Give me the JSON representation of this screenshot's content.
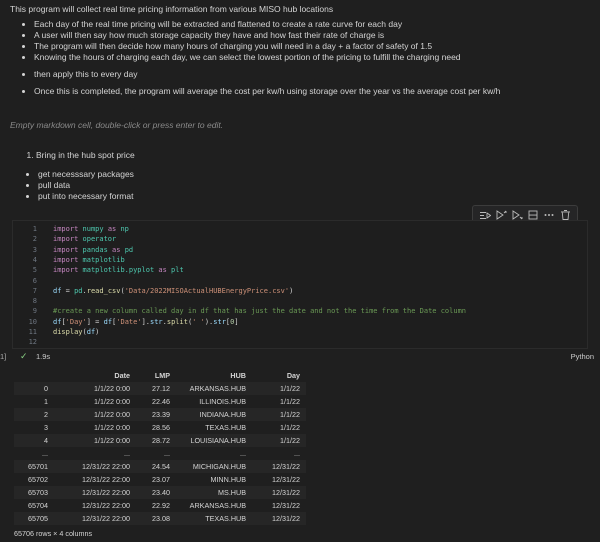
{
  "intro": {
    "text": "This program will collect real time pricing information from various MISO hub locations",
    "bullets": [
      "Each day of the real time pricing will be extracted and flattened to create a rate curve for each day",
      "A user will then say how much storage capacity they have and how fast their rate of charge is",
      "The program will then decide how many hours of charging you will need in a day + a factor of safety of 1.5",
      "Knowing the hours of charging each day, we can select the lowest portion of the pricing to fulfill the charging need"
    ],
    "bullet2": "then apply this to every day",
    "bullet3": "Once this is completed, the program will average the cost per kw/h using storage over the year vs the average cost per kw/h"
  },
  "empty_cell": "Empty markdown cell, double-click or press enter to edit.",
  "md2": {
    "ol_item": "Bring in the hub spot price",
    "bullets": [
      "get necesssary packages",
      "pull data",
      "put into necessary format"
    ]
  },
  "toolbar_icons": [
    "run-by-line-icon",
    "execute-above-icon",
    "execute-below-icon",
    "split-cell-icon",
    "more-icon",
    "delete-icon"
  ],
  "code": {
    "line_numbers": [
      "1",
      "2",
      "3",
      "4",
      "5",
      "6",
      "7",
      "8",
      "9",
      "10",
      "11",
      "12"
    ],
    "l1": [
      "import",
      "numpy",
      "as",
      "np"
    ],
    "l2": [
      "import",
      "operator"
    ],
    "l3": [
      "import",
      "pandas",
      "as",
      "pd"
    ],
    "l4": [
      "import",
      "matplotlib"
    ],
    "l5": [
      "import",
      "matplotlib.pyplot",
      "as",
      "plt"
    ],
    "l7": [
      "df",
      "=",
      "pd",
      ".",
      "read_csv",
      "(",
      "'Data/2022MISOActualHUBEnergyPrice.csv'",
      ")"
    ],
    "l9": "#create a new column called day in df that has just the date and not the time from the Date column",
    "l10": [
      "df",
      "[",
      "'Day'",
      "] =",
      "df",
      "[",
      "'Date'",
      "].",
      "str",
      ".",
      "split",
      "(",
      "' '",
      ").",
      "str",
      "[",
      "0",
      "]"
    ],
    "l11": [
      "display",
      "(",
      "df",
      ")"
    ]
  },
  "status": {
    "marker": "1]",
    "check": "✓",
    "time": "1.9s",
    "language": "Python"
  },
  "table": {
    "columns": [
      "",
      "Date",
      "LMP",
      "HUB",
      "Day"
    ],
    "rows": [
      [
        "0",
        "1/1/22 0:00",
        "27.12",
        "ARKANSAS.HUB",
        "1/1/22"
      ],
      [
        "1",
        "1/1/22 0:00",
        "22.46",
        "ILLINOIS.HUB",
        "1/1/22"
      ],
      [
        "2",
        "1/1/22 0:00",
        "23.39",
        "INDIANA.HUB",
        "1/1/22"
      ],
      [
        "3",
        "1/1/22 0:00",
        "28.56",
        "TEXAS.HUB",
        "1/1/22"
      ],
      [
        "4",
        "1/1/22 0:00",
        "28.72",
        "LOUISIANA.HUB",
        "1/1/22"
      ],
      [
        "...",
        "...",
        "...",
        "...",
        "..."
      ],
      [
        "65701",
        "12/31/22 22:00",
        "24.54",
        "MICHIGAN.HUB",
        "12/31/22"
      ],
      [
        "65702",
        "12/31/22 22:00",
        "23.07",
        "MINN.HUB",
        "12/31/22"
      ],
      [
        "65703",
        "12/31/22 22:00",
        "23.40",
        "MS.HUB",
        "12/31/22"
      ],
      [
        "65704",
        "12/31/22 22:00",
        "22.92",
        "ARKANSAS.HUB",
        "12/31/22"
      ],
      [
        "65705",
        "12/31/22 22:00",
        "23.08",
        "TEXAS.HUB",
        "12/31/22"
      ]
    ],
    "footer": "65706 rows × 4 columns"
  }
}
